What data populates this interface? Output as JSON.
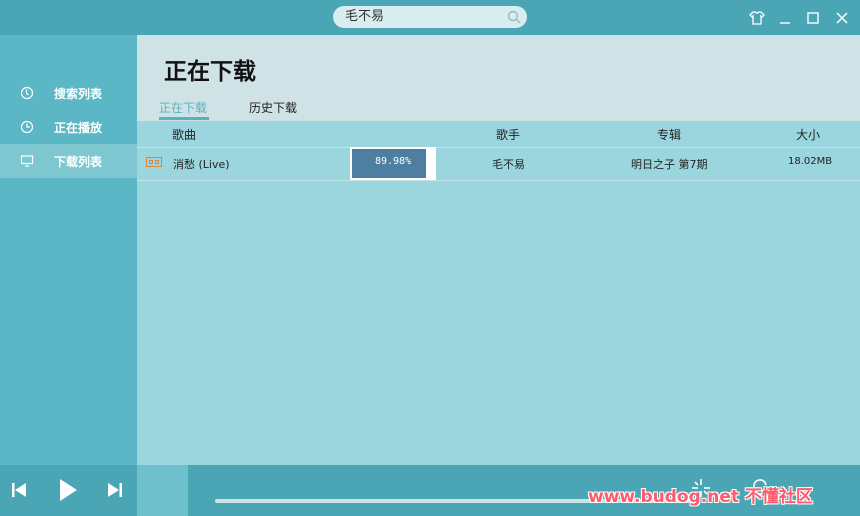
{
  "search": {
    "value": "毛不易"
  },
  "sidebar": {
    "items": [
      {
        "label": "搜索列表"
      },
      {
        "label": "正在播放"
      },
      {
        "label": "下载列表"
      }
    ]
  },
  "header": {
    "title": "正在下载",
    "tabs": [
      {
        "label": "正在下载"
      },
      {
        "label": "历史下载"
      }
    ]
  },
  "table": {
    "columns": [
      "歌曲",
      "歌手",
      "专辑",
      "大小"
    ],
    "rows": [
      {
        "song": "消愁 (Live)",
        "progress_text": "89.98%",
        "progress": 0.8998,
        "artist": "毛不易",
        "album": "明日之子 第7期",
        "size": "18.02MB"
      }
    ]
  },
  "watermark": {
    "text": "www.budog.net 不懂社区"
  },
  "colors": {
    "accent": "#4aa6b5",
    "sidebar": "#5bb7c6",
    "content": "#9bd5de",
    "progress": "#4e7ea0",
    "watermark": "#ff5a6e"
  }
}
